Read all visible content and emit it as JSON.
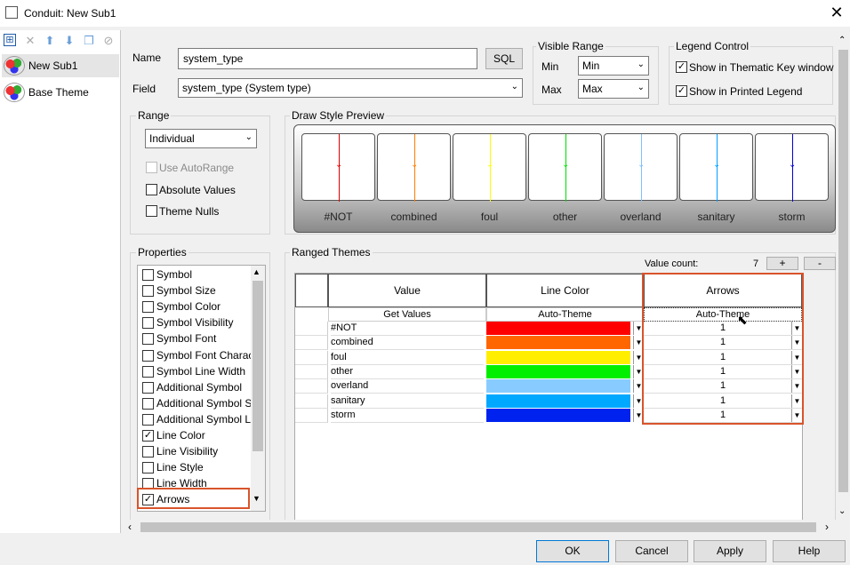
{
  "window": {
    "title": "Conduit: New Sub1",
    "close": "✕"
  },
  "toolbar": {
    "icons": [
      "add-theme-icon",
      "delete-icon",
      "move-up-icon",
      "move-down-icon",
      "copy-icon",
      "disable-icon"
    ]
  },
  "tree": {
    "items": [
      {
        "label": "New Sub1"
      },
      {
        "label": "Base Theme"
      }
    ]
  },
  "form": {
    "name_label": "Name",
    "name_value": "system_type",
    "sql_button": "SQL",
    "field_label": "Field",
    "field_value": "system_type (System type)",
    "visible_range": {
      "title": "Visible Range",
      "min_label": "Min",
      "min_value": "Min",
      "max_label": "Max",
      "max_value": "Max"
    },
    "legend": {
      "title": "Legend Control",
      "show_thematic": "Show in Thematic Key window",
      "show_printed": "Show in Printed Legend"
    },
    "range": {
      "title": "Range",
      "mode": "Individual",
      "use_autorange": "Use AutoRange",
      "absolute_values": "Absolute Values",
      "theme_nulls": "Theme Nulls"
    }
  },
  "preview": {
    "title": "Draw Style Preview",
    "items": [
      {
        "label": "#NOT",
        "color": "#e00000"
      },
      {
        "label": "combined",
        "color": "#ff7f00"
      },
      {
        "label": "foul",
        "color": "#ffff00"
      },
      {
        "label": "other",
        "color": "#00e000"
      },
      {
        "label": "overland",
        "color": "#80c0ff"
      },
      {
        "label": "sanitary",
        "color": "#00a0ff"
      },
      {
        "label": "storm",
        "color": "#0000d0"
      }
    ]
  },
  "properties": {
    "title": "Properties",
    "items": [
      {
        "label": "Symbol",
        "checked": false
      },
      {
        "label": "Symbol Size",
        "checked": false
      },
      {
        "label": "Symbol Color",
        "checked": false
      },
      {
        "label": "Symbol Visibility",
        "checked": false
      },
      {
        "label": "Symbol Font",
        "checked": false
      },
      {
        "label": "Symbol Font Charact",
        "checked": false
      },
      {
        "label": "Symbol Line Width",
        "checked": false
      },
      {
        "label": "Additional Symbol",
        "checked": false
      },
      {
        "label": "Additional Symbol Si",
        "checked": false
      },
      {
        "label": "Additional Symbol Li",
        "checked": false
      },
      {
        "label": "Line Color",
        "checked": true
      },
      {
        "label": "Line Visibility",
        "checked": false
      },
      {
        "label": "Line Style",
        "checked": false
      },
      {
        "label": "Line Width",
        "checked": false
      },
      {
        "label": "Arrows",
        "checked": true
      }
    ]
  },
  "ranged": {
    "title": "Ranged Themes",
    "value_count_label": "Value count:",
    "value_count": "7",
    "plus": "+",
    "minus": "-",
    "headers": {
      "value": "Value",
      "line_color": "Line Color",
      "arrows": "Arrows"
    },
    "subheaders": {
      "value": "Get Values",
      "line_color": "Auto-Theme",
      "arrows": "Auto-Theme"
    },
    "rows": [
      {
        "value": "#NOT",
        "color": "#ff0000",
        "arrows": "1"
      },
      {
        "value": "combined",
        "color": "#ff6600",
        "arrows": "1"
      },
      {
        "value": "foul",
        "color": "#ffee00",
        "arrows": "1"
      },
      {
        "value": "other",
        "color": "#00ee00",
        "arrows": "1"
      },
      {
        "value": "overland",
        "color": "#88ccff",
        "arrows": "1"
      },
      {
        "value": "sanitary",
        "color": "#00a8ff",
        "arrows": "1"
      },
      {
        "value": "storm",
        "color": "#0022ee",
        "arrows": "1"
      }
    ]
  },
  "buttons": {
    "ok": "OK",
    "cancel": "Cancel",
    "apply": "Apply",
    "help": "Help"
  }
}
